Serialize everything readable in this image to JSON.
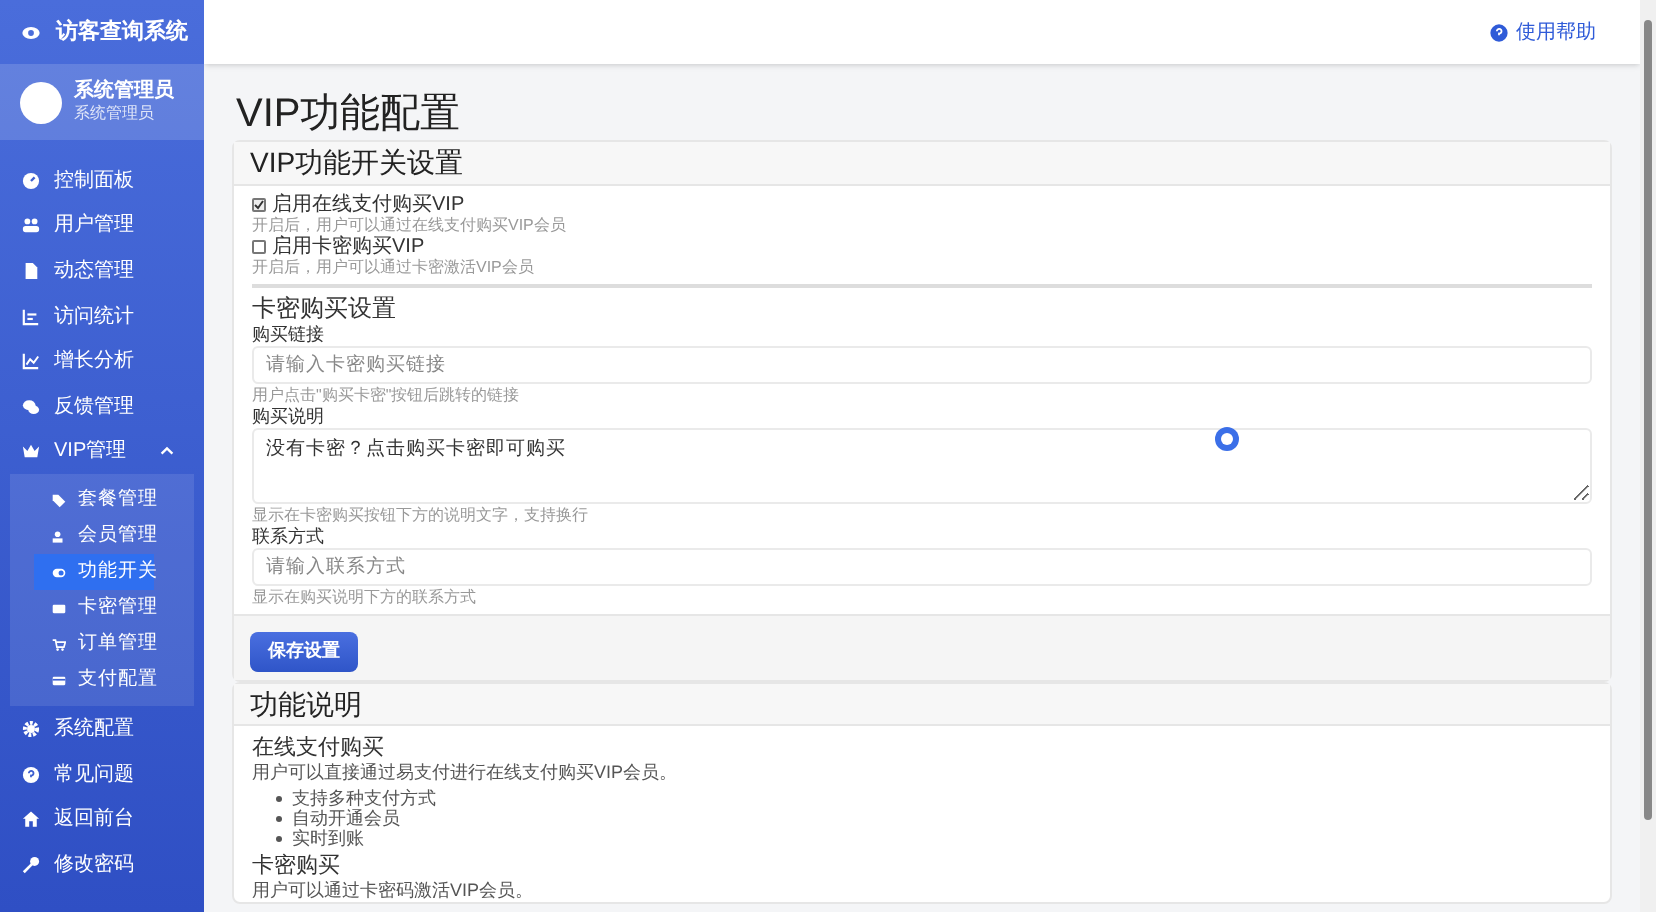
{
  "sidebar": {
    "brand": "访客查询系统",
    "user": {
      "name": "系统管理员",
      "role": "系统管理员"
    },
    "items": [
      {
        "label": "控制面板",
        "selected": false
      },
      {
        "label": "用户管理",
        "selected": false
      },
      {
        "label": "动态管理",
        "selected": false
      },
      {
        "label": "访问统计",
        "selected": false
      },
      {
        "label": "增长分析",
        "selected": false
      },
      {
        "label": "反馈管理",
        "selected": false
      },
      {
        "label": "VIP管理",
        "selected": false,
        "expanded": true,
        "children": [
          {
            "label": "套餐管理",
            "selected": false
          },
          {
            "label": "会员管理",
            "selected": false
          },
          {
            "label": "功能开关",
            "selected": true
          },
          {
            "label": "卡密管理",
            "selected": false
          },
          {
            "label": "订单管理",
            "selected": false
          },
          {
            "label": "支付配置",
            "selected": false
          }
        ]
      },
      {
        "label": "系统配置",
        "selected": false
      },
      {
        "label": "常见问题",
        "selected": false
      },
      {
        "label": "返回前台",
        "selected": false
      },
      {
        "label": "修改密码",
        "selected": false
      }
    ]
  },
  "header": {
    "help_link": "使用帮助"
  },
  "page_title": "VIP功能配置",
  "switch_card": {
    "title": "VIP功能开关设置",
    "options": [
      {
        "label": "启用在线支付购买VIP",
        "checked": true,
        "hint": "开启后，用户可以通过在线支付购买VIP会员"
      },
      {
        "label": "启用卡密购买VIP",
        "checked": false,
        "hint": "开启后，用户可以通过卡密激活VIP会员"
      }
    ],
    "section_title": "卡密购买设置",
    "fields": [
      {
        "kind": "input",
        "label": "购买链接",
        "placeholder": "请输入卡密购买链接",
        "hint": "用户点击\"购买卡密\"按钮后跳转的链接"
      },
      {
        "kind": "textarea",
        "label": "购买说明",
        "value": "没有卡密？点击购买卡密即可购买",
        "hint": "显示在卡密购买按钮下方的说明文字，支持换行"
      },
      {
        "kind": "input",
        "label": "联系方式",
        "placeholder": "请输入联系方式",
        "hint": "显示在购买说明下方的联系方式"
      }
    ],
    "save_button": "保存设置"
  },
  "info_card": {
    "title": "功能说明",
    "sections": [
      {
        "heading": "在线支付购买",
        "text": "用户可以直接通过易支付进行在线支付购买VIP会员。",
        "bullets": [
          "支持多种支付方式",
          "自动开通会员",
          "实时到账"
        ]
      },
      {
        "heading": "卡密购买",
        "text": "用户可以通过卡密码激活VIP会员。"
      }
    ]
  }
}
